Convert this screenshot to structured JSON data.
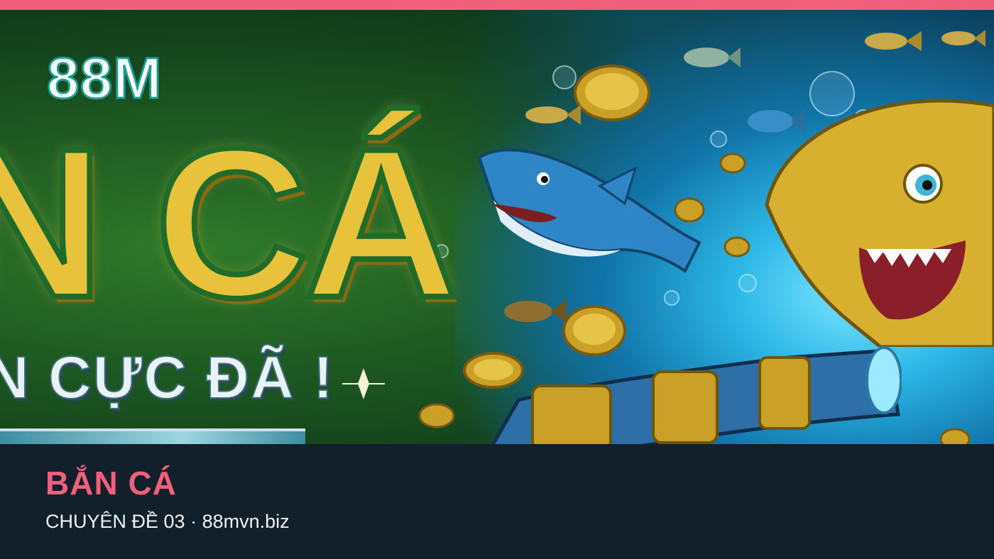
{
  "colors": {
    "accent": "#f0607a",
    "background": "#12202b",
    "text": "#eef2f4",
    "banner_green": "#1e5a22",
    "banner_blue": "#1174a8",
    "gold": "#e8c23a"
  },
  "banner": {
    "logo": "88M",
    "headline": "N CÁ",
    "subline": "N CỰC ĐÃ !",
    "image_icons": [
      "shark-icon",
      "coin-icon",
      "cannon-icon",
      "fish-icon",
      "bubble-icon",
      "sparkle-icon"
    ]
  },
  "card": {
    "title": "BẮN CÁ",
    "series": "CHUYÊN ĐỀ 03",
    "separator": "·",
    "domain": "88mvn.biz"
  }
}
